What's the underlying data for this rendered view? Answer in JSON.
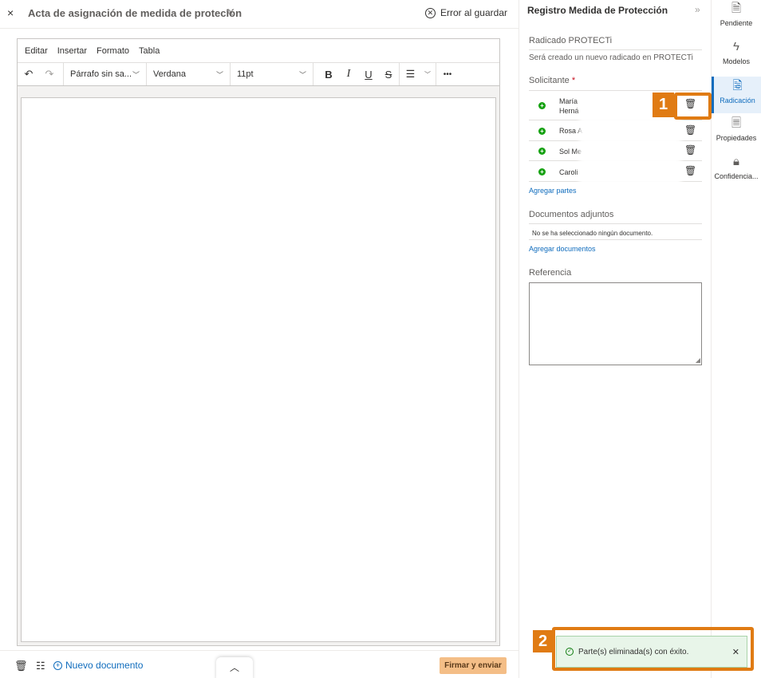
{
  "header": {
    "close_glyph": "×",
    "doc_title": "Acta de asignación de medida de proteción",
    "save_status": "Error al guardar"
  },
  "editor": {
    "menu": [
      "Editar",
      "Insertar",
      "Formato",
      "Tabla"
    ],
    "block_format": "Párrafo sin sa...",
    "font": "Verdana",
    "size": "11pt",
    "bold": "B",
    "italic": "I",
    "underline": "U",
    "strike": "S",
    "more": "•••"
  },
  "footer": {
    "new_document": "Nuevo documento",
    "sign_send": "Firmar y enviar"
  },
  "panel": {
    "title": "Registro Medida de Protección",
    "radicado_label": "Radicado PROTECTi",
    "radicado_value": "Será creado un nuevo radicado en PROTECTi",
    "solicitante_label": "Solicitante",
    "required_mark": "*",
    "parties": [
      {
        "name_line1": "María",
        "name_line2": "Herná"
      },
      {
        "name_line1": "Rosa A",
        "name_line2": ""
      },
      {
        "name_line1": "Sol Me",
        "name_line2": ""
      },
      {
        "name_line1": "Caroli",
        "name_line2": ""
      }
    ],
    "add_parties": "Agregar partes",
    "attachments_label": "Documentos adjuntos",
    "no_document": "No se ha seleccionado ningún documento.",
    "add_documents": "Agregar documentos",
    "reference_label": "Referencia"
  },
  "rail": [
    {
      "label": "Pendiente",
      "icon": "pending-doc-icon"
    },
    {
      "label": "Modelos",
      "icon": "lightning-icon"
    },
    {
      "label": "Radicación",
      "icon": "radication-doc-icon",
      "active": true
    },
    {
      "label": "Propiedades",
      "icon": "properties-doc-icon"
    },
    {
      "label": "Confidencia...",
      "icon": "lock-icon"
    }
  ],
  "callouts": {
    "one": "1",
    "two": "2"
  },
  "toast": {
    "message": "Parte(s) eliminada(s) con éxito."
  },
  "colors": {
    "accent": "#0f6cbd",
    "callout": "#e07b13",
    "success": "#13a10e",
    "sign_button": "#f4be87"
  }
}
